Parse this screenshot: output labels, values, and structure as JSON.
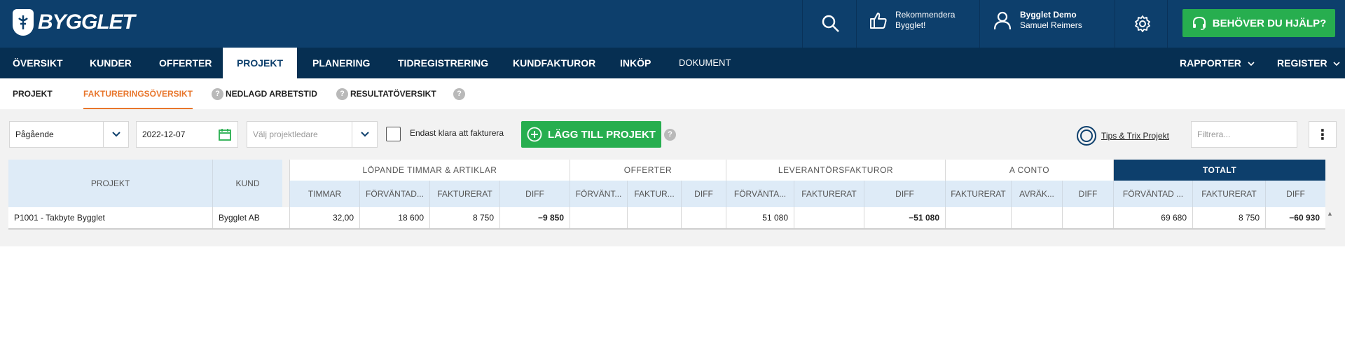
{
  "brand": {
    "name": "BYGGLET",
    "accent": "#27ae4f",
    "navy": "#0d3f6c"
  },
  "topbar": {
    "recommend_line1": "Rekommendera",
    "recommend_line2": "Bygglet!",
    "user_name": "Bygglet Demo",
    "user_sub": "Samuel Reimers",
    "help_label": "BEHÖVER DU HJÄLP?"
  },
  "nav": {
    "items": [
      "ÖVERSIKT",
      "KUNDER",
      "OFFERTER",
      "PROJEKT",
      "PLANERING",
      "TIDREGISTRERING",
      "KUNDFAKTUROR",
      "INKÖP",
      "DOKUMENT"
    ],
    "right": [
      "RAPPORTER",
      "REGISTER"
    ]
  },
  "subnav": {
    "items": [
      "PROJEKT",
      "FAKTURERINGSÖVERSIKT",
      "NEDLAGD ARBETSTID",
      "RESULTATÖVERSIKT"
    ],
    "qmark": "?"
  },
  "toolbar": {
    "status_value": "Pågående",
    "date_value": "2022-12-07",
    "leader_placeholder": "Välj projektledare",
    "checkbox_label": "Endast klara att fakturera",
    "add_label": "LÄGG TILL PROJEKT",
    "tips_label": "Tips & Trix Projekt",
    "filter_placeholder": "Filtrera...",
    "more_glyph": "⋮"
  },
  "table": {
    "groups": [
      "LÖPANDE TIMMAR & ARTIKLAR",
      "OFFERTER",
      "LEVERANTÖRSFAKTUROR",
      "A CONTO",
      "TOTALT"
    ],
    "left_headers": [
      "PROJEKT",
      "KUND"
    ],
    "columns": [
      "TIMMAR",
      "FÖRVÄNTAD...",
      "FAKTURERAT",
      "DIFF",
      "FÖRVÄNT...",
      "FAKTUR...",
      "DIFF",
      "FÖRVÄNTA...",
      "FAKTURERAT",
      "DIFF",
      "FAKTURERAT",
      "AVRÄK...",
      "DIFF",
      "FÖRVÄNTAD ...",
      "FAKTURERAT",
      "DIFF"
    ],
    "rows": [
      {
        "project": "P1001 - Takbyte Bygglet",
        "customer": "Bygglet AB",
        "values": [
          "32,00",
          "18 600",
          "8 750",
          "−9 850",
          "",
          "",
          "",
          "51 080",
          "",
          "−51 080",
          "",
          "",
          "",
          "69 680",
          "8 750",
          "−60 930"
        ]
      }
    ]
  }
}
